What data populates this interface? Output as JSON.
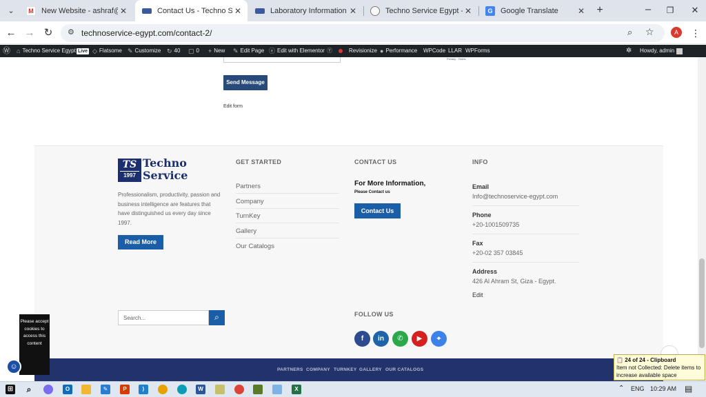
{
  "browser": {
    "tabs": [
      {
        "title": "New Website - ashraf@tech",
        "icon": "gmail-icon",
        "active": false
      },
      {
        "title": "Contact Us - Techno Service",
        "icon": "site-icon",
        "active": true
      },
      {
        "title": "Laboratory Information Mar",
        "icon": "site-icon",
        "active": false
      },
      {
        "title": "Techno Service Egypt - Auto",
        "icon": "globe-icon",
        "active": false
      },
      {
        "title": "Google Translate",
        "icon": "translate-icon",
        "active": false
      }
    ],
    "url": "technoservice-egypt.com/contact-2/",
    "profile_initial": "A"
  },
  "adminbar": {
    "site_name": "Techno Service Egypt",
    "live": "Live",
    "flatsome": "Flatsome",
    "customize": "Customize",
    "updates": "40",
    "comments": "0",
    "new": "New",
    "edit_page": "Edit Page",
    "edit_elementor": "Edit with Elementor",
    "revisionize": "Revisionize",
    "performance": "Performance",
    "wpcode": "WPCode",
    "llar": "LLAR",
    "wpforms": "WPForms",
    "howdy": "Howdy, admin"
  },
  "form": {
    "send_label": "Send Message",
    "edit_form": "Edit form",
    "recaptcha_links": "Privacy - Terms"
  },
  "footer": {
    "logo_badge": "TS",
    "logo_year": "1997",
    "logo_line1": "Techno",
    "logo_line2": "Service",
    "about": "Professionalism, productivity, passion and business intelligence are features that have distinguished us every day since 1997.",
    "read_more": "Read More",
    "search_placeholder": "Search...",
    "get_started_title": "GET STARTED",
    "get_started_links": [
      "Partners",
      "Company",
      "TurnKey",
      "Gallery",
      "Our Catalogs"
    ],
    "contact_title": "CONTACT US",
    "contact_heading": "For More Information,",
    "contact_sub": "Please Contact us",
    "contact_button": "Contact Us",
    "follow_title": "FOLLOW US",
    "info_title": "INFO",
    "email_label": "Email",
    "email": "Info@technoservice-egypt.com",
    "phone_label": "Phone",
    "phone": "+20-1001509735",
    "fax_label": "Fax",
    "fax": "+20-02 357 03845",
    "address_label": "Address",
    "address": "426 Al Ahram St, Giza - Egypt.",
    "edit": "Edit",
    "bottom_menu": [
      "PARTNERS",
      "COMPANY",
      "TURNKEY",
      "GALLERY",
      "OUR CATALOGS"
    ]
  },
  "cookie": {
    "text": "Please accept cookies to access this content"
  },
  "clipboard": {
    "title": "24 of 24 - Clipboard",
    "message": "Item not Collected: Delete items to increase available space"
  },
  "taskbar": {
    "lang": "ENG",
    "time": "10:29 AM"
  },
  "colors": {
    "brand_blue": "#1b5ea8",
    "footer_bar": "#22336b",
    "adminbar": "#1d2327"
  }
}
